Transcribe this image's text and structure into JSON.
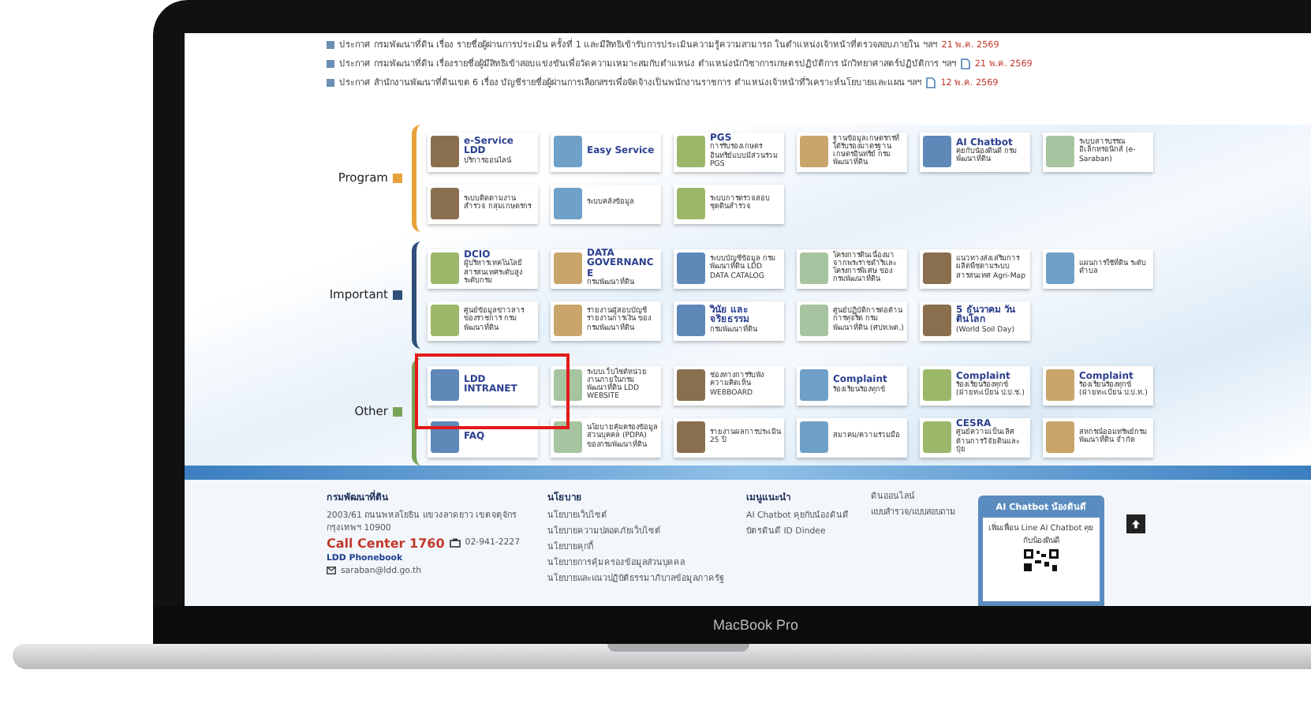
{
  "announcements": [
    {
      "text": "ประกาศ กรมพัฒนาที่ดิน เรื่อง รายชื่อผู้ผ่านการประเมิน ครั้งที่ 1 และมีสิทธิเข้ารับการประเมินความรู้ความสามารถ ในตำแหน่งเจ้าหน้าที่ตรวจสอบภายใน ฯลฯ",
      "attachment": false,
      "date": "21 พ.ค. 2569"
    },
    {
      "text": "ประกาศ กรมพัฒนาที่ดิน เรื่องรายชื่อผู้มีสิทธิเข้าสอบแข่งขันเพื่อวัดความเหมาะสมกับตำแหน่ง ตำแหน่งนักวิชาการเกษตรปฏิบัติการ นักวิทยาศาสตร์ปฏิบัติการ ฯลฯ",
      "attachment": true,
      "date": "21 พ.ค. 2569"
    },
    {
      "text": "ประกาศ สำนักงานพัฒนาที่ดินเขต 6 เรื่อง บัญชีรายชื่อผู้ผ่านการเลือกสรรเพื่อจัดจ้างเป็นพนักงานราชการ ตำแหน่งเจ้าหน้าที่วิเคราะห์นโยบายและแผน ฯลฯ",
      "attachment": true,
      "date": "12 พ.ค. 2569"
    }
  ],
  "sections": [
    {
      "label": "Program",
      "kind": "program",
      "rows": [
        [
          {
            "title": "e-Service LDD",
            "text": "บริการออนไลน์",
            "highlighted": false
          },
          {
            "title": "Easy Service",
            "highlighted": false
          },
          {
            "title": "PGS",
            "text": "การรับรองเกษตรอินทรีย์แบบมีส่วนร่วม PGS",
            "highlighted": false
          },
          {
            "text": "ฐานข้อมูลเกษตรกรที่ได้รับรองมาตรฐานเกษตรอินทรีย์ กรมพัฒนาที่ดิน",
            "highlighted": false
          },
          {
            "title": "AI Chatbot",
            "text": "คุยกับน้องดินดี กรมพัฒนาที่ดิน",
            "highlighted": false
          },
          {
            "text": "ระบบสารบรรณอิเล็กทรอนิกส์ (e-Saraban)",
            "highlighted": false
          }
        ],
        [
          {
            "text": "ระบบติดตามงาน สำรวจ กลุ่มเกษตรกร",
            "highlighted": false
          },
          {
            "text": "ระบบคลังข้อมูล",
            "highlighted": false
          },
          {
            "text": "ระบบการตรวจสอบ ชุดดินสำรวจ",
            "highlighted": false
          }
        ]
      ]
    },
    {
      "label": "Important",
      "kind": "important",
      "rows": [
        [
          {
            "title": "DCIO",
            "text": "ผู้บริหารเทคโนโลยีสารสนเทศระดับสูงระดับกรม",
            "highlighted": false
          },
          {
            "title": "DATA GOVERNANCE",
            "text": "กรมพัฒนาที่ดิน",
            "highlighted": false
          },
          {
            "text": "ระบบบัญชีข้อมูล กรมพัฒนาที่ดิน LDD DATA CATALOG",
            "highlighted": false
          },
          {
            "text": "โครงการดินเนื่องมาจากพระราชดำริและโครงการพิเศษ ของกรมพัฒนาที่ดิน",
            "highlighted": false
          },
          {
            "text": "แนวทางส่งเสริมการผลิตพืชตามระบบสารสนเทศ Agri-Map",
            "highlighted": false
          },
          {
            "text": "แผนการใช้ที่ดิน ระดับตำบล",
            "highlighted": false
          }
        ],
        [
          {
            "text": "ศูนย์ข้อมูลข่าวสารของราชการ กรมพัฒนาที่ดิน",
            "highlighted": false
          },
          {
            "text": "รายงานผู้สอบบัญชี รายงานการเงิน ของกรมพัฒนาที่ดิน",
            "highlighted": false
          },
          {
            "title": "วินัย และจริยธรรม",
            "text": "กรมพัฒนาที่ดิน",
            "highlighted": false
          },
          {
            "text": "ศูนย์ปฏิบัติการต่อต้านการทุจริต กรมพัฒนาที่ดิน (ศปท.พด.)",
            "highlighted": false
          },
          {
            "title": "5 ธันวาคม วันดินโลก",
            "text": "(World Soil Day)",
            "highlighted": false
          }
        ]
      ]
    },
    {
      "label": "Other",
      "kind": "other",
      "rows": [
        [
          {
            "title": "LDD INTRANET",
            "highlighted": true
          },
          {
            "text": "ระบบเว็บไซต์หน่วยงานภายในกรมพัฒนาที่ดิน LDD WEBSITE",
            "highlighted": false
          },
          {
            "text": "ช่องทางการรับฟังความคิดเห็น WEBBOARD",
            "highlighted": false
          },
          {
            "title": "Complaint",
            "text": "ร้องเรียนร้องทุกข์",
            "highlighted": false
          },
          {
            "title": "Complaint",
            "text": "ร้องเรียนร้องทุกข์ (ฝ่ายทะเบียน ป.ป.ช.)",
            "highlighted": false
          },
          {
            "title": "Complaint",
            "text": "ร้องเรียนร้องทุกข์ (ฝ่ายทะเบียน ป.ป.ท.)",
            "highlighted": false
          }
        ],
        [
          {
            "title": "FAQ",
            "highlighted": false
          },
          {
            "text": "นโยบายคุ้มครองข้อมูลส่วนบุคคล (PDPA) ของกรมพัฒนาที่ดิน",
            "highlighted": false
          },
          {
            "text": "รายงานผลการประเมิน 25 ปี",
            "highlighted": false
          },
          {
            "text": "สมาคม/ความร่วมมือ",
            "highlighted": false
          },
          {
            "title": "CESRA",
            "text": "ศูนย์ความเป็นเลิศด้านการวิจัยดินและปุ๋ย",
            "highlighted": false
          },
          {
            "text": "สหกรณ์ออมทรัพย์กรมพัฒนาที่ดิน จำกัด",
            "highlighted": false
          }
        ]
      ]
    }
  ],
  "footer": {
    "org": {
      "name": "กรมพัฒนาที่ดิน",
      "address": "2003/61 ถนนพหลโยธิน แขวงลาดยาว เขตจตุจักร กรุงเทพฯ 10900",
      "call_center": "Call Center 1760",
      "phone": "02-941-2227",
      "phonebook": "LDD Phonebook",
      "email": "saraban@ldd.go.th"
    },
    "columns": [
      {
        "heading": "นโยบาย",
        "links": [
          "นโยบายเว็บไซต์",
          "นโยบายความปลอดภัยเว็บไซต์",
          "นโยบายคุกกี้",
          "นโยบายการคุ้มครองข้อมูลส่วนบุคคล",
          "นโยบายและแนวปฏิบัติธรรมาภิบาลข้อมูลภาครัฐ"
        ]
      },
      {
        "heading": "เมนูแนะนำ",
        "links": [
          "AI Chatbot คุยกับน้องดินดี",
          "บัตรดินดี ID Dindee"
        ]
      },
      {
        "links": [
          "ดินออนไลน์",
          "แบบสำรวจ/แบบสอบถาม"
        ]
      }
    ],
    "chatbot": {
      "title": "AI Chatbot น้องดินดี",
      "text": "เพิ่มเพื่อน Line AI Chatbot คุยกับน้องดินดี"
    }
  },
  "device_label": "MacBook Pro"
}
